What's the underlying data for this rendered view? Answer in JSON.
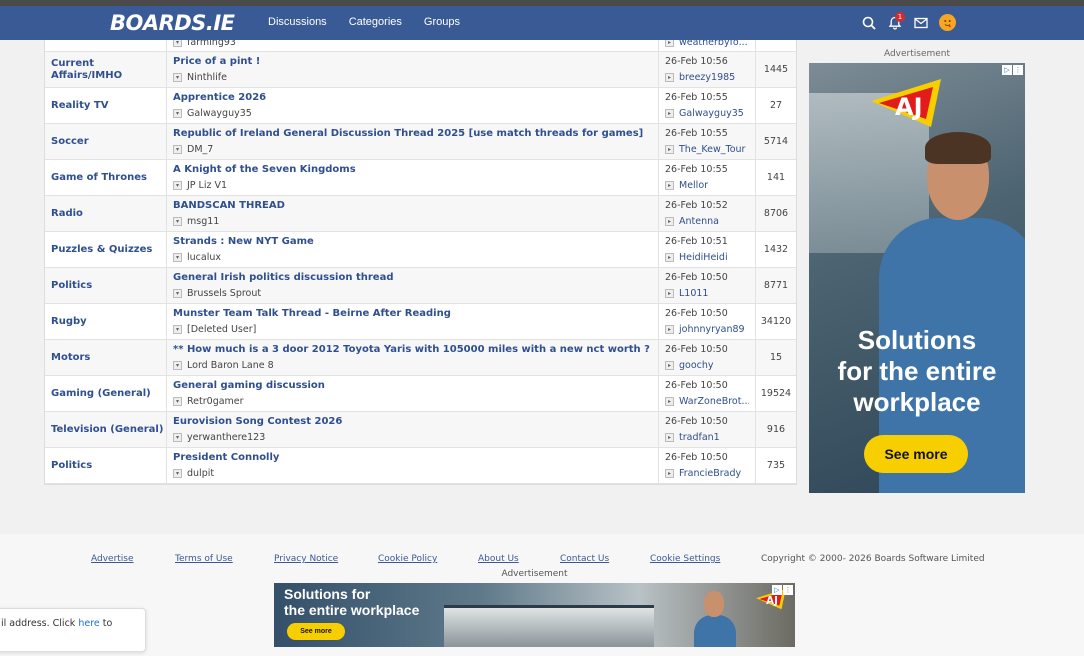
{
  "header": {
    "logo": "BOARDS.IE",
    "nav": [
      "Discussions",
      "Categories",
      "Groups"
    ],
    "notification_count": "1"
  },
  "threads": [
    {
      "category": "",
      "title": "",
      "starter": "farming93",
      "date": "",
      "last_user": "weatherbyfo...",
      "replies": ""
    },
    {
      "category": "Current Affairs/IMHO",
      "title": "Price of a pint !",
      "starter": "Ninthlife",
      "date": "26-Feb 10:56",
      "last_user": "breezy1985",
      "replies": "1445"
    },
    {
      "category": "Reality TV",
      "title": "Apprentice 2026",
      "starter": "Galwayguy35",
      "date": "26-Feb 10:55",
      "last_user": "Galwayguy35",
      "replies": "27"
    },
    {
      "category": "Soccer",
      "title": "Republic of Ireland General Discussion Thread 2025 [use match threads for games]",
      "starter": "DM_7",
      "date": "26-Feb 10:55",
      "last_user": "The_Kew_Tour",
      "replies": "5714"
    },
    {
      "category": "Game of Thrones",
      "title": "A Knight of the Seven Kingdoms",
      "starter": "JP Liz V1",
      "date": "26-Feb 10:55",
      "last_user": "Mellor",
      "replies": "141"
    },
    {
      "category": "Radio",
      "title": "BANDSCAN THREAD",
      "starter": "msg11",
      "date": "26-Feb 10:52",
      "last_user": "Antenna",
      "replies": "8706"
    },
    {
      "category": "Puzzles & Quizzes",
      "title": "Strands : New NYT Game",
      "starter": "lucalux",
      "date": "26-Feb 10:51",
      "last_user": "HeidiHeidi",
      "replies": "1432"
    },
    {
      "category": "Politics",
      "title": "General Irish politics discussion thread",
      "starter": "Brussels Sprout",
      "date": "26-Feb 10:50",
      "last_user": "L1011",
      "replies": "8771"
    },
    {
      "category": "Rugby",
      "title": "Munster Team Talk Thread - Beirne After Reading",
      "starter": "[Deleted User]",
      "date": "26-Feb 10:50",
      "last_user": "johnnyryan89",
      "replies": "34120"
    },
    {
      "category": "Motors",
      "title": "** How much is a 3 door 2012 Toyota Yaris with 105000 miles with a new nct worth ?",
      "starter": "Lord Baron Lane 8",
      "date": "26-Feb 10:50",
      "last_user": "goochy",
      "replies": "15"
    },
    {
      "category": "Gaming (General)",
      "title": "General gaming discussion",
      "starter": "Retr0gamer",
      "date": "26-Feb 10:50",
      "last_user": "WarZoneBrot...",
      "replies": "19524"
    },
    {
      "category": "Television (General)",
      "title": "Eurovision Song Contest 2026",
      "starter": "yerwanthere123",
      "date": "26-Feb 10:50",
      "last_user": "tradfan1",
      "replies": "916"
    },
    {
      "category": "Politics",
      "title": "President Connolly",
      "starter": "dulpit",
      "date": "26-Feb 10:50",
      "last_user": "FrancieBrady",
      "replies": "735"
    }
  ],
  "ad_right": {
    "label": "Advertisement",
    "headline_lines": [
      "Solutions",
      "for the entire",
      "workplace"
    ],
    "cta": "See more",
    "brand": "AJ"
  },
  "footer": {
    "links": [
      "Advertise",
      "Terms of Use",
      "Privacy Notice",
      "Cookie Policy",
      "About Us",
      "Contact Us",
      "Cookie Settings"
    ],
    "copyright": "Copyright © 2000- 2026 Boards Software Limited"
  },
  "ad_bottom": {
    "label": "Advertisement",
    "headline_lines": [
      "Solutions for",
      "the entire workplace"
    ],
    "cta": "See more"
  },
  "toast": {
    "text_before": "il address. Click ",
    "link": "here",
    "text_after": " to"
  }
}
